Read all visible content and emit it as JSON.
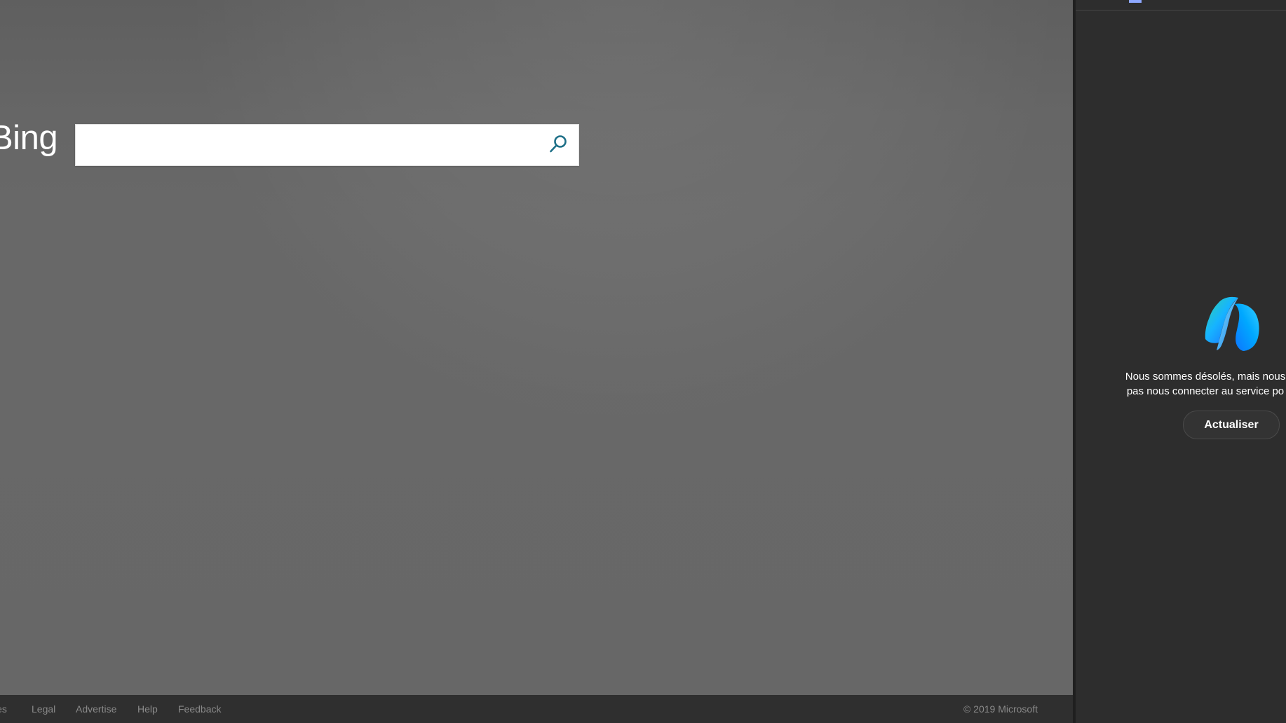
{
  "bing": {
    "logo_text": "Bing",
    "search": {
      "value": "",
      "placeholder": "",
      "icon": "search-icon"
    },
    "footer": {
      "links": [
        "ies",
        "Legal",
        "Advertise",
        "Help",
        "Feedback"
      ],
      "copyright": "© 2019 Microsoft"
    },
    "colors": {
      "background": "#666666",
      "search_icon": "#1d6f87",
      "footer_bg": "#2f2f2f"
    }
  },
  "copilot": {
    "logo_icon": "copilot-logo-icon",
    "message_lines": [
      "Nous sommes désolés, mais nous",
      "pas nous connecter au service po"
    ],
    "refresh_label": "Actualiser",
    "colors": {
      "panel_bg": "#2d2d2d",
      "accent": "#8ea8ff"
    }
  }
}
